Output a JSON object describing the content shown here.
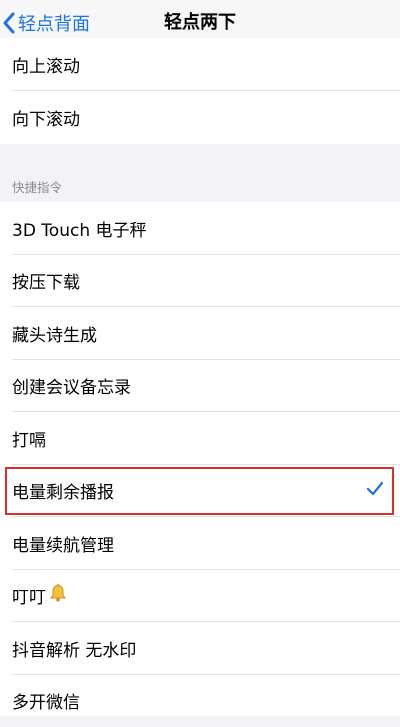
{
  "navbar": {
    "back_label": "轻点背面",
    "title": "轻点两下"
  },
  "top_group": {
    "items": [
      {
        "label": "向上滚动"
      },
      {
        "label": "向下滚动"
      }
    ]
  },
  "shortcuts": {
    "header": "快捷指令",
    "items": [
      {
        "label": "3D Touch 电子秤",
        "selected": false
      },
      {
        "label": "按压下载",
        "selected": false
      },
      {
        "label": "藏头诗生成",
        "selected": false
      },
      {
        "label": "创建会议备忘录",
        "selected": false
      },
      {
        "label": "打嗝",
        "selected": false
      },
      {
        "label": "电量剩余播报",
        "selected": true
      },
      {
        "label": "电量续航管理",
        "selected": false
      },
      {
        "label": "叮叮",
        "selected": false,
        "icon": "bell-icon"
      },
      {
        "label": "抖音解析 无水印",
        "selected": false
      },
      {
        "label": "多开微信",
        "selected": false
      }
    ]
  },
  "colors": {
    "accent": "#1a73e8",
    "highlight_border": "#d9302a",
    "background": "#f2f2f7"
  }
}
